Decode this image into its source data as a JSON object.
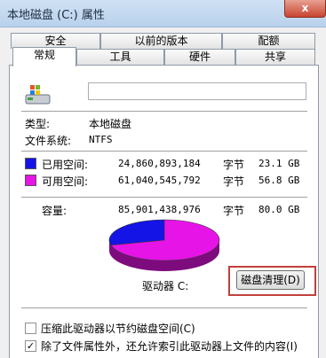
{
  "window": {
    "title": "本地磁盘 (C:) 属性",
    "close_glyph": "x"
  },
  "tabs": {
    "row1": [
      "安全",
      "以前的版本",
      "配额"
    ],
    "row2": [
      "常规",
      "工具",
      "硬件",
      "共享"
    ],
    "active": "常规"
  },
  "general": {
    "drive_name_value": "",
    "type_label": "类型:",
    "type_value": "本地磁盘",
    "fs_label": "文件系统:",
    "fs_value": "NTFS",
    "used": {
      "label": "已用空间:",
      "bytes": "24,860,893,184",
      "unit": "字节",
      "size": "23.1 GB",
      "color": "#1414e6"
    },
    "free": {
      "label": "可用空间:",
      "bytes": "61,040,545,792",
      "unit": "字节",
      "size": "56.8 GB",
      "color": "#e614e6"
    },
    "capacity": {
      "label": "容量:",
      "bytes": "85,901,438,976",
      "unit": "字节",
      "size": "80.0 GB"
    },
    "drive_label": "驱动器 C:",
    "cleanup_button": "磁盘清理(D)",
    "compress_checkbox": {
      "label": "压缩此驱动器以节约磁盘空间(C)",
      "checked": false
    },
    "index_checkbox": {
      "label": "除了文件属性外，还允许索引此驱动器上文件的内容(I)",
      "checked": true
    }
  },
  "chart_data": {
    "type": "pie",
    "categories": [
      "已用空间",
      "可用空间"
    ],
    "values": [
      24860893184,
      61040545792
    ],
    "colors": [
      "#1414e6",
      "#e614e6"
    ]
  }
}
